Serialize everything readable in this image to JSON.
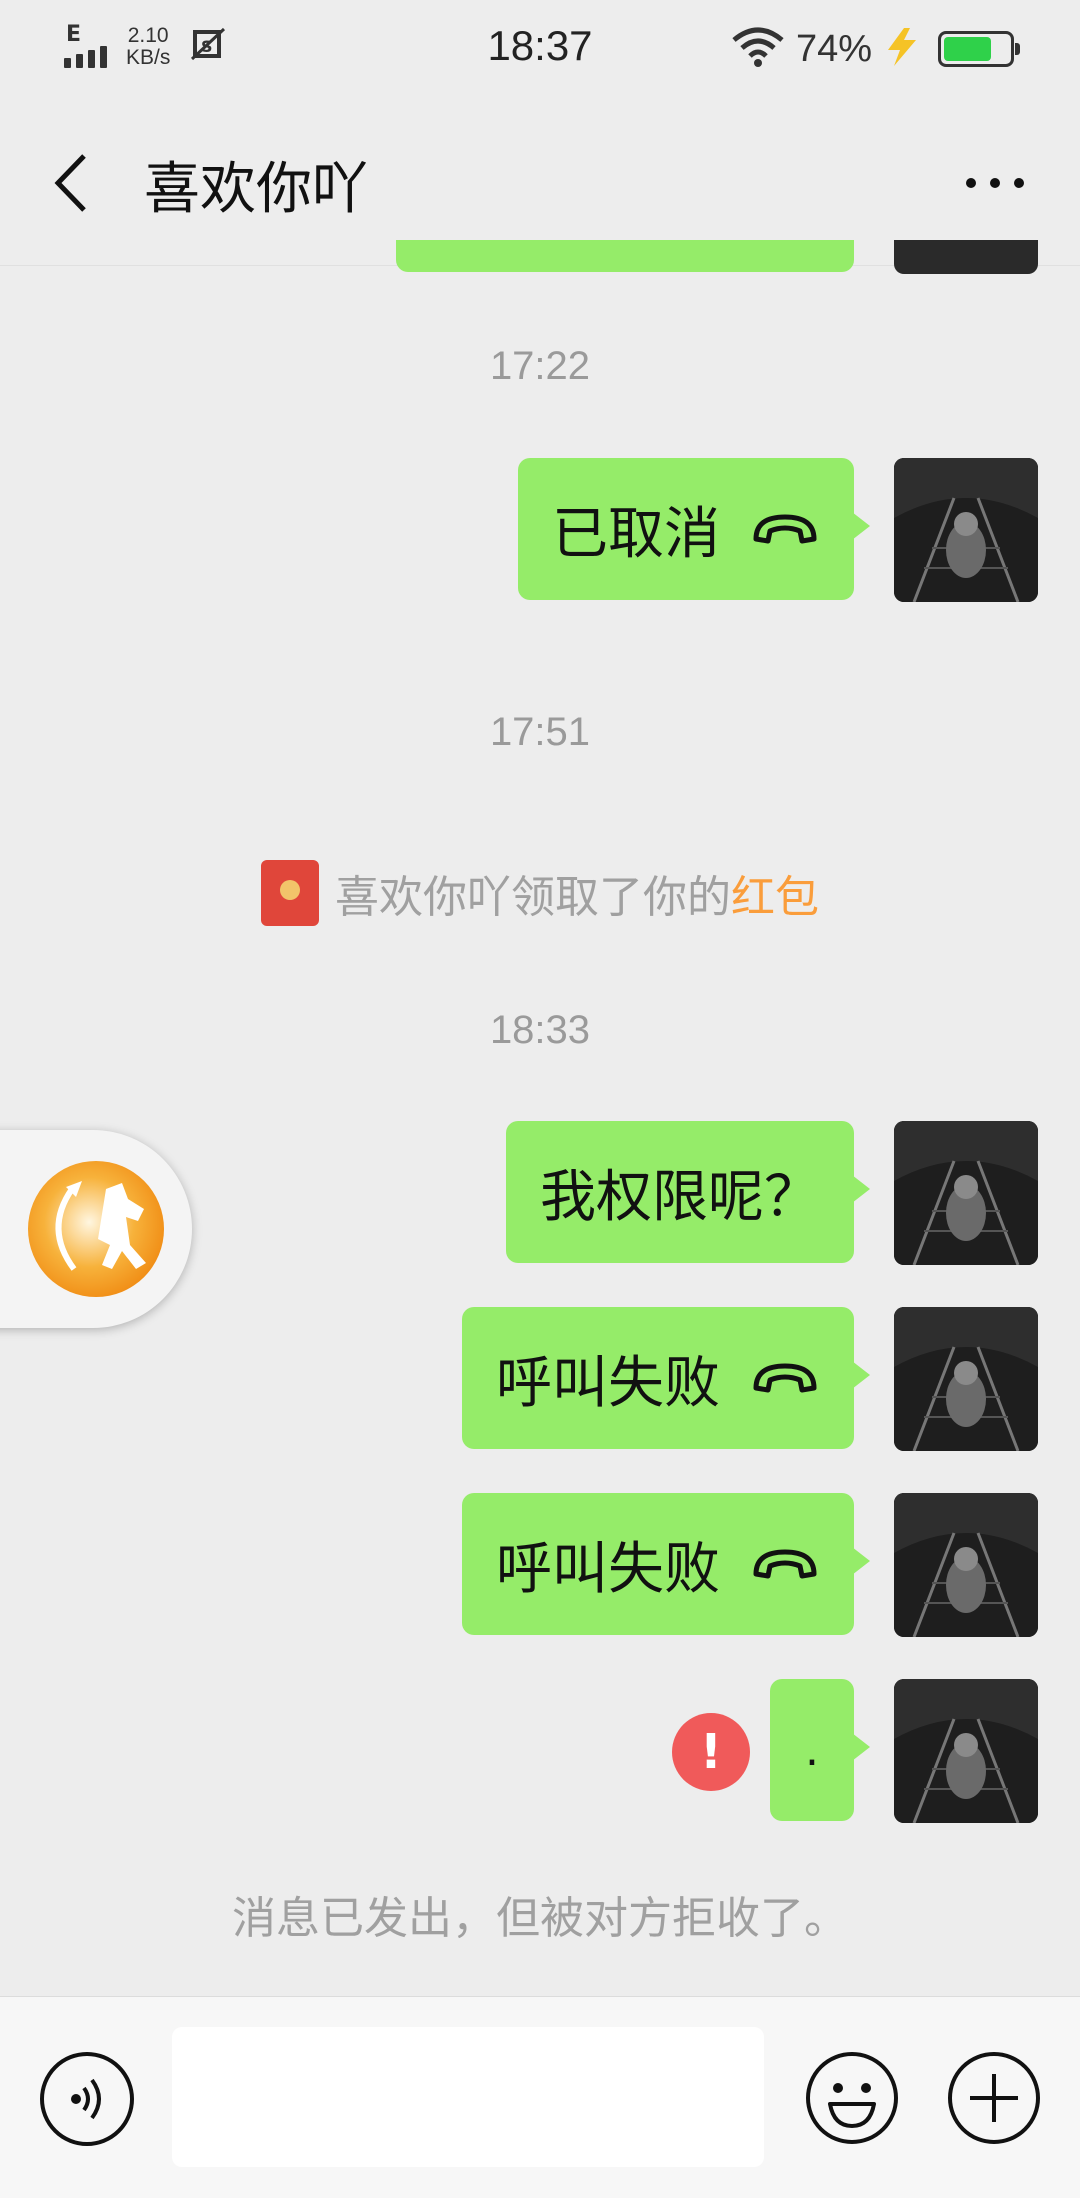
{
  "status_bar": {
    "network_type": "E",
    "speed_value": "2.10",
    "speed_unit": "KB/s",
    "time": "18:37",
    "battery_percent": "74%",
    "battery_level": 0.74,
    "icons": [
      "signal-icon",
      "screenshot-notice-icon",
      "wifi-icon",
      "charging-icon",
      "battery-icon"
    ]
  },
  "header": {
    "title": "喜欢你吖",
    "back_icon": "chevron-left-icon",
    "more_icon": "more-dots-icon"
  },
  "timestamps": [
    "17:22",
    "17:51",
    "18:33"
  ],
  "messages": [
    {
      "text": "已取消",
      "icon": "hangup-phone-icon"
    },
    {
      "text": "我权限呢？"
    },
    {
      "text": "呼叫失败",
      "icon": "hangup-phone-icon"
    },
    {
      "text": "呼叫失败",
      "icon": "hangup-phone-icon"
    },
    {
      "text": ".",
      "status": "failed"
    }
  ],
  "system_message": {
    "prefix": "喜欢你吖领取了你的",
    "highlight": "红包",
    "icon": "red-packet-icon"
  },
  "error_badge": "!",
  "reject_note": "消息已发出，但被对方拒收了。",
  "input_bar": {
    "placeholder": "",
    "voice_icon": "voice-icon",
    "emoji_icon": "emoji-icon",
    "plus_icon": "plus-icon"
  },
  "colors": {
    "bubble": "#95ec69",
    "background": "#ededed",
    "highlight": "#fa9d3b",
    "error": "#f05a5a"
  }
}
